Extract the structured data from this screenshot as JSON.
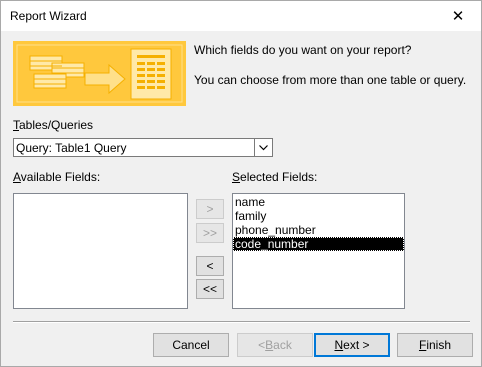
{
  "window": {
    "title": "Report Wizard",
    "close_glyph": "✕"
  },
  "header": {
    "question": "Which fields do you want on your report?",
    "hint": "You can choose from more than one table or query."
  },
  "tables_queries": {
    "label_u": "T",
    "label_rest": "ables/Queries",
    "value": "Query: Table1 Query"
  },
  "available": {
    "label_u": "A",
    "label_rest": "vailable Fields:",
    "items": []
  },
  "selected": {
    "label_u": "S",
    "label_rest": "elected Fields:",
    "items": [
      "name",
      "family",
      "phone_number",
      "code_number"
    ],
    "selected_index": 3
  },
  "move_buttons": {
    "add_one": ">",
    "add_all": ">>",
    "remove_one": "<",
    "remove_all": "<<"
  },
  "footer": {
    "cancel": "Cancel",
    "back_u": "B",
    "back_pre": "< ",
    "back_post": "ack",
    "next_u": "N",
    "next_post": "ext >",
    "finish_u": "F",
    "finish_post": "inish"
  },
  "colors": {
    "illustration_bg": "#ffc83d",
    "default_button_border": "#0078d7"
  }
}
